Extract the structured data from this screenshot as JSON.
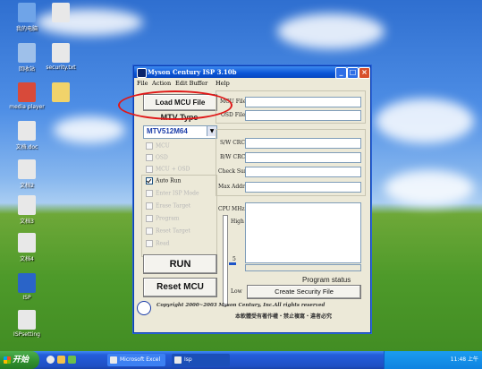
{
  "desktop": {
    "icons": [
      {
        "name": "my-computer",
        "caption": "我的电脑",
        "glyph_color": "#6fa4e8"
      },
      {
        "name": "file-top",
        "caption": "",
        "glyph_color": "#e8e8e8"
      },
      {
        "name": "recycle",
        "caption": "回收站",
        "glyph_color": "#9ec0ea"
      },
      {
        "name": "text-file",
        "caption": "security.txt",
        "glyph_color": "#e8e8e8"
      },
      {
        "name": "media-player",
        "caption": "media player",
        "glyph_color": "#d84a3a"
      },
      {
        "name": "folder",
        "caption": "",
        "glyph_color": "#f1d36a"
      },
      {
        "name": "file-1",
        "caption": "文档.doc",
        "glyph_color": "#e8e8e8"
      },
      {
        "name": "file-2",
        "caption": "文档2",
        "glyph_color": "#e8e8e8"
      },
      {
        "name": "file-3",
        "caption": "文档3",
        "glyph_color": "#e8e8e8"
      },
      {
        "name": "file-4",
        "caption": "文档4",
        "glyph_color": "#e8e8e8"
      },
      {
        "name": "isp-shortcut",
        "caption": "ISP",
        "glyph_color": "#2a64c8"
      },
      {
        "name": "file-5",
        "caption": "ISPsetting",
        "glyph_color": "#e8e8e8"
      }
    ]
  },
  "window": {
    "title": "Myson Century ISP 3.10b",
    "menu": [
      "File",
      "Action",
      "Edit Buffer",
      "Help"
    ],
    "load_button": "Load MCU File",
    "mtv_type_label": "MTV Type",
    "mtv_type_value": "MTV512M64",
    "checkboxes": [
      {
        "label": "MCU",
        "checked": false
      },
      {
        "label": "OSD",
        "checked": false
      },
      {
        "label": "MCU + OSD",
        "checked": false
      },
      {
        "label": "Auto Run",
        "checked": true
      },
      {
        "label": "Enter ISP Mode",
        "checked": false
      },
      {
        "label": "Erase Target",
        "checked": false
      },
      {
        "label": "Program",
        "checked": false
      },
      {
        "label": "Reset Target",
        "checked": false
      },
      {
        "label": "Read",
        "checked": false
      }
    ],
    "file_fields": [
      {
        "label": "MCU File",
        "value": ""
      },
      {
        "label": "OSD File",
        "value": ""
      }
    ],
    "crc_fields": [
      {
        "label": "S/W CRC",
        "value": ""
      },
      {
        "label": "B/W CRC",
        "value": ""
      },
      {
        "label": "Check Sum",
        "value": ""
      },
      {
        "label": "Max Addr.",
        "value": ""
      }
    ],
    "cpu_label": "CPU",
    "mhz_label": "MHz",
    "high_label": "High",
    "low_label": "Low",
    "slider_mid": "5",
    "run_button": "RUN",
    "reset_button": "Reset MCU",
    "program_status": "Program status",
    "security_button": "Create Security File",
    "copyright": "Copyright 2000~2003 Myson Century, Inc.All rights reserved",
    "copyright_cn": "本軟體受有著作權・禁止複寫・違者必究"
  },
  "taskbar": {
    "start": "开始",
    "items": [
      {
        "label": "Microsoft Excel"
      },
      {
        "label": "Isp"
      }
    ],
    "tray_text": "11:48 上午"
  }
}
